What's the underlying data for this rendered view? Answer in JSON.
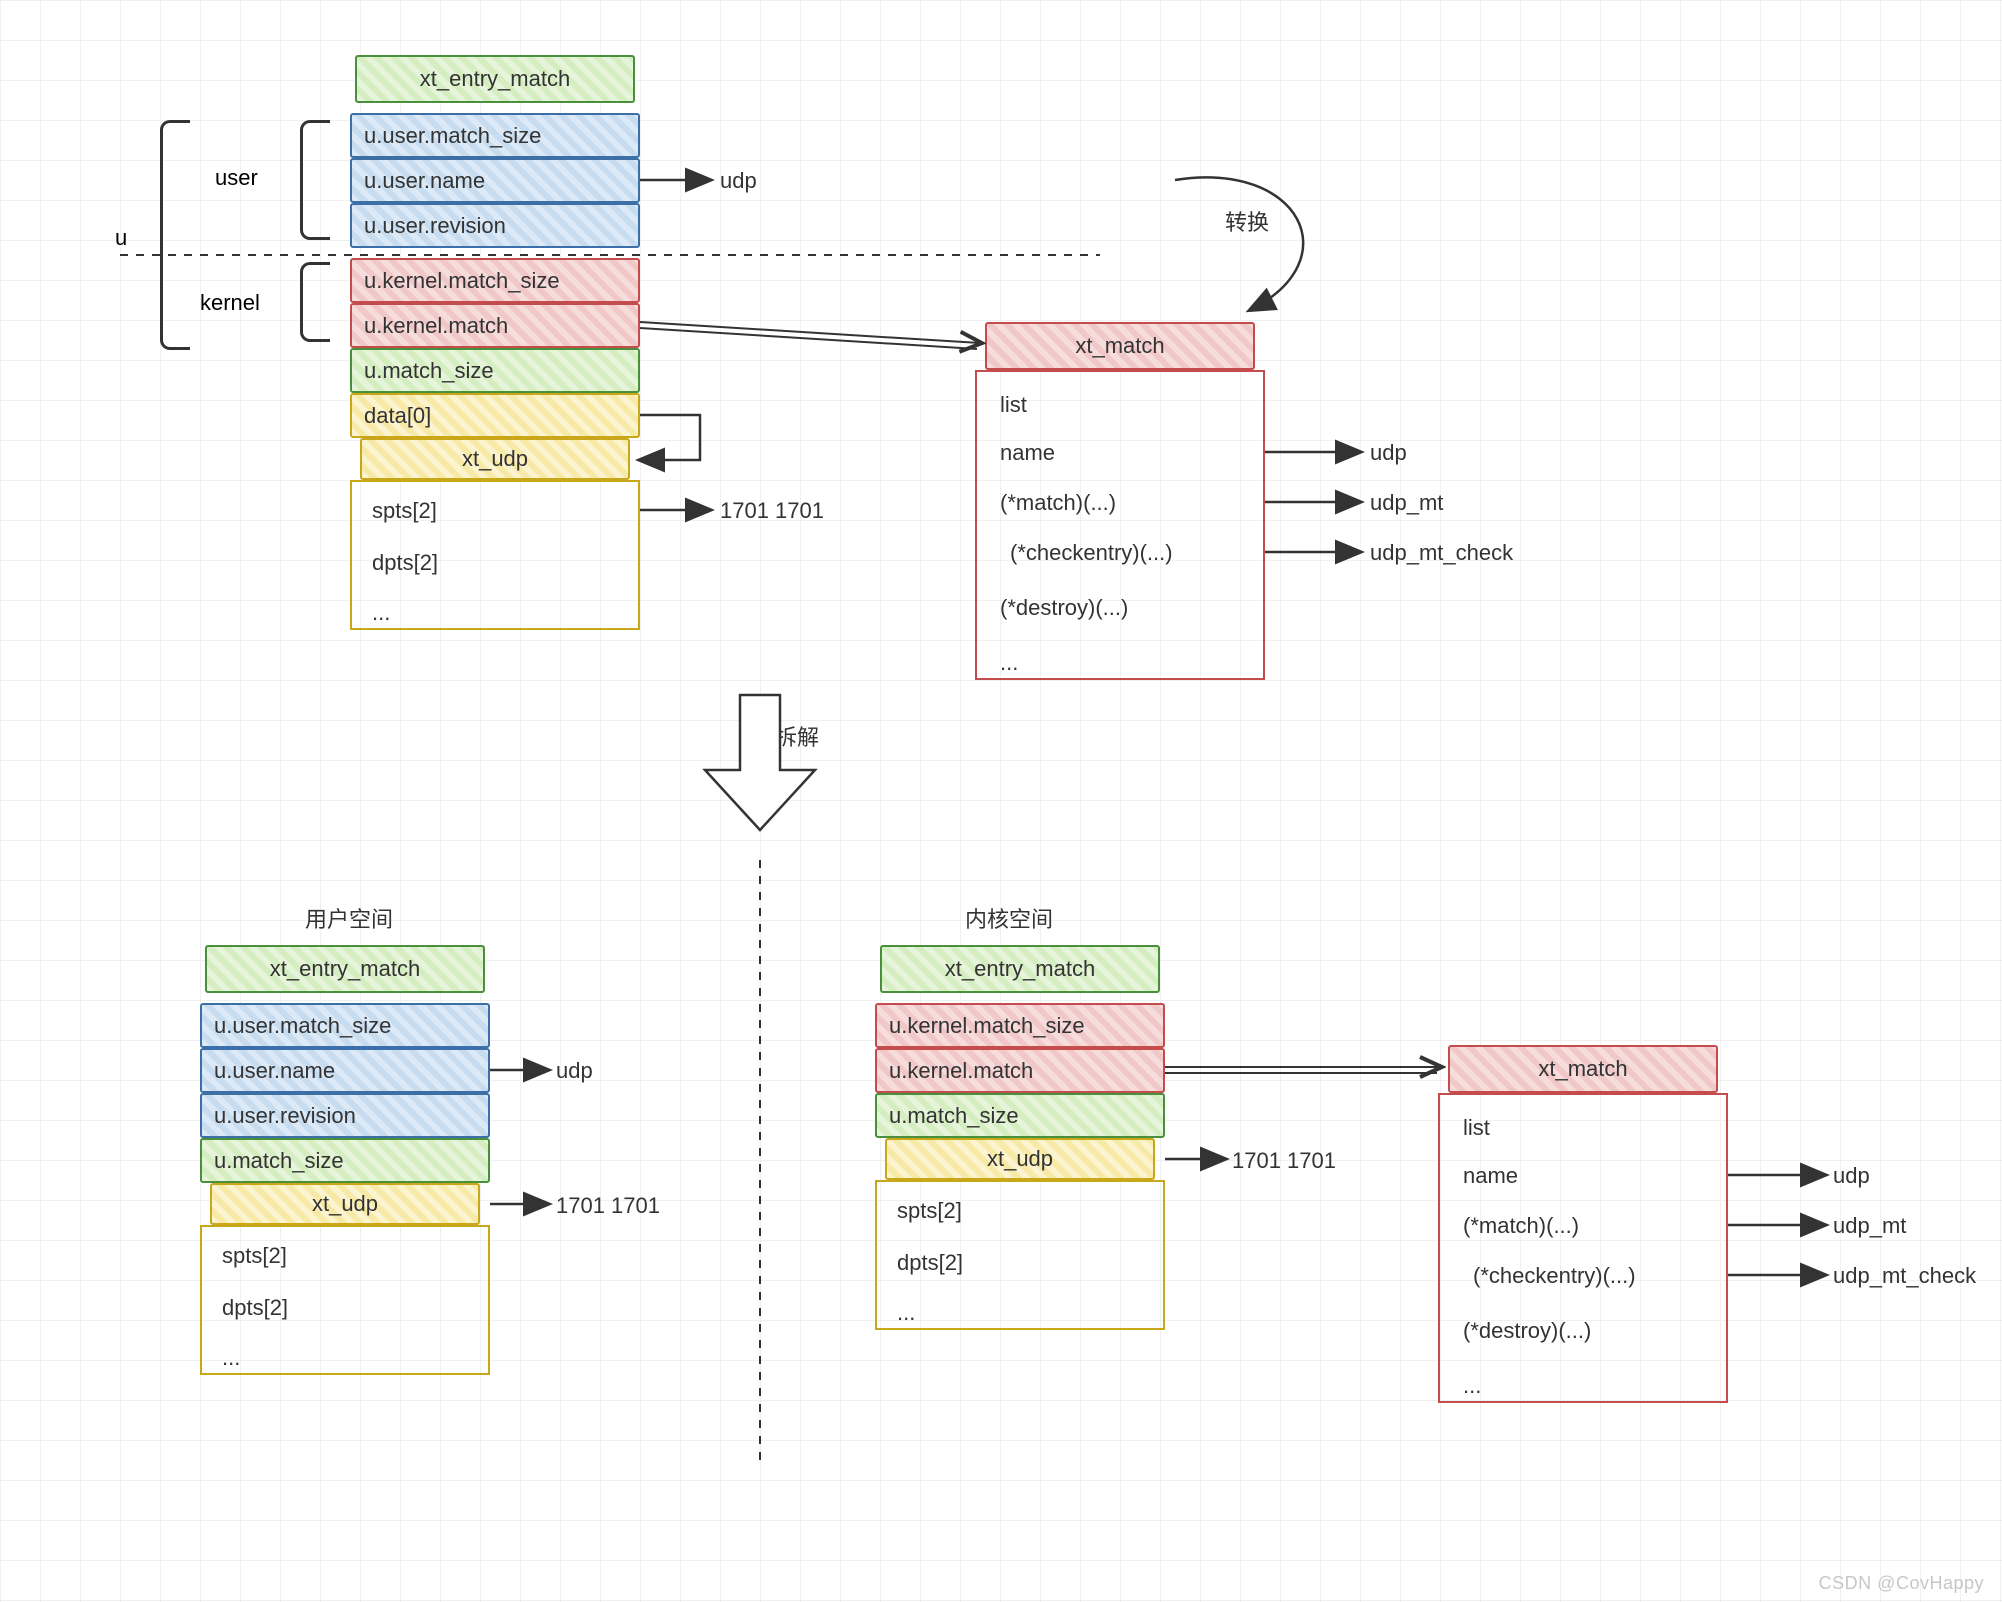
{
  "labels": {
    "u": "u",
    "user": "user",
    "kernel": "kernel",
    "transform": "转换",
    "decompose": "拆解",
    "userspace": "用户空间",
    "kernelspace": "内核空间",
    "watermark": "CSDN @CovHappy"
  },
  "top": {
    "xt_entry_match": "xt_entry_match",
    "u_user_match_size": "u.user.match_size",
    "u_user_name": "u.user.name",
    "u_user_revision": "u.user.revision",
    "u_kernel_match_size": "u.kernel.match_size",
    "u_kernel_match": "u.kernel.match",
    "u_match_size": "u.match_size",
    "data0": "data[0]",
    "xt_udp": "xt_udp",
    "spts2": "spts[2]",
    "dpts2": "dpts[2]",
    "ellipsis": "...",
    "udp": "udp",
    "ports": "1701 1701"
  },
  "xt_match": {
    "title": "xt_match",
    "list": "list",
    "name": "name",
    "match": "(*match)(...)",
    "checkentry": "(*checkentry)(...)",
    "destroy": "(*destroy)(...)",
    "ellipsis": "...",
    "udp": "udp",
    "udp_mt": "udp_mt",
    "udp_mt_check": "udp_mt_check"
  },
  "user_block": {
    "xt_entry_match": "xt_entry_match",
    "u_user_match_size": "u.user.match_size",
    "u_user_name": "u.user.name",
    "u_user_revision": "u.user.revision",
    "u_match_size": "u.match_size",
    "xt_udp": "xt_udp",
    "spts2": "spts[2]",
    "dpts2": "dpts[2]",
    "ellipsis": "...",
    "udp": "udp",
    "ports": "1701 1701"
  },
  "kernel_block": {
    "xt_entry_match": "xt_entry_match",
    "u_kernel_match_size": "u.kernel.match_size",
    "u_kernel_match": "u.kernel.match",
    "u_match_size": "u.match_size",
    "xt_udp": "xt_udp",
    "spts2": "spts[2]",
    "dpts2": "dpts[2]",
    "ellipsis": "...",
    "ports": "1701 1701"
  }
}
